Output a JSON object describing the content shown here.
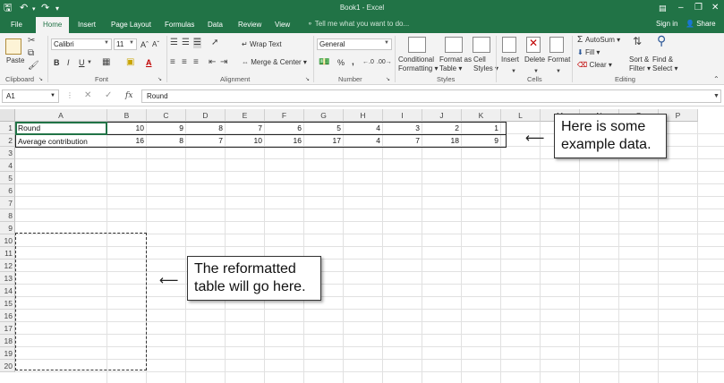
{
  "window": {
    "title": "Book1 - Excel",
    "quick_access": [
      "save-icon",
      "undo-icon",
      "redo-icon",
      "customize-icon"
    ],
    "controls": [
      "minimize-icon",
      "restore-icon",
      "maximize-icon",
      "close-icon"
    ]
  },
  "tabs": [
    "File",
    "Home",
    "Insert",
    "Page Layout",
    "Formulas",
    "Data",
    "Review",
    "View"
  ],
  "active_tab": "Home",
  "tell_me": "Tell me what you want to do...",
  "sign_in": "Sign in",
  "share": "Share",
  "ribbon": {
    "clipboard": {
      "label": "Clipboard",
      "paste": "Paste"
    },
    "font": {
      "label": "Font",
      "name": "Calibri",
      "size": "11",
      "bold": "B",
      "italic": "I",
      "underline": "U"
    },
    "alignment": {
      "label": "Alignment",
      "wrap_text": "Wrap Text",
      "merge_center": "Merge & Center"
    },
    "number": {
      "label": "Number",
      "format": "General",
      "percent": "%",
      "comma": ","
    },
    "styles": {
      "label": "Styles",
      "conditional": [
        "Conditional",
        "Formatting ▾"
      ],
      "format_table": [
        "Format as",
        "Table ▾"
      ],
      "cell_styles": [
        "Cell",
        "Styles ▾"
      ]
    },
    "cells": {
      "label": "Cells",
      "insert": "Insert",
      "delete": "Delete",
      "format": "Format"
    },
    "editing": {
      "label": "Editing",
      "autosum": "AutoSum",
      "fill": "Fill",
      "clear": "Clear",
      "sort_filter": [
        "Sort &",
        "Filter ▾"
      ],
      "find_select": [
        "Find &",
        "Select ▾"
      ]
    }
  },
  "formula_bar": {
    "name_box": "A1",
    "fx": "fx",
    "content": "Round"
  },
  "columns": [
    "A",
    "B",
    "C",
    "D",
    "E",
    "F",
    "G",
    "H",
    "I",
    "J",
    "K",
    "L",
    "M",
    "N",
    "O",
    "P"
  ],
  "rows": [
    "1",
    "2",
    "3",
    "4",
    "5",
    "6",
    "7",
    "8",
    "9",
    "10",
    "11",
    "12",
    "13",
    "14",
    "15",
    "16",
    "17",
    "18",
    "19",
    "20"
  ],
  "cells": {
    "row1": {
      "label": "Round",
      "values": [
        "10",
        "9",
        "8",
        "7",
        "6",
        "5",
        "4",
        "3",
        "2",
        "1"
      ]
    },
    "row2": {
      "label": "Average contribution",
      "values": [
        "16",
        "8",
        "7",
        "10",
        "16",
        "17",
        "4",
        "7",
        "18",
        "9"
      ]
    }
  },
  "callouts": {
    "example": [
      "Here is some",
      "example data."
    ],
    "reformat": [
      "The reformatted",
      "table will go here."
    ]
  }
}
